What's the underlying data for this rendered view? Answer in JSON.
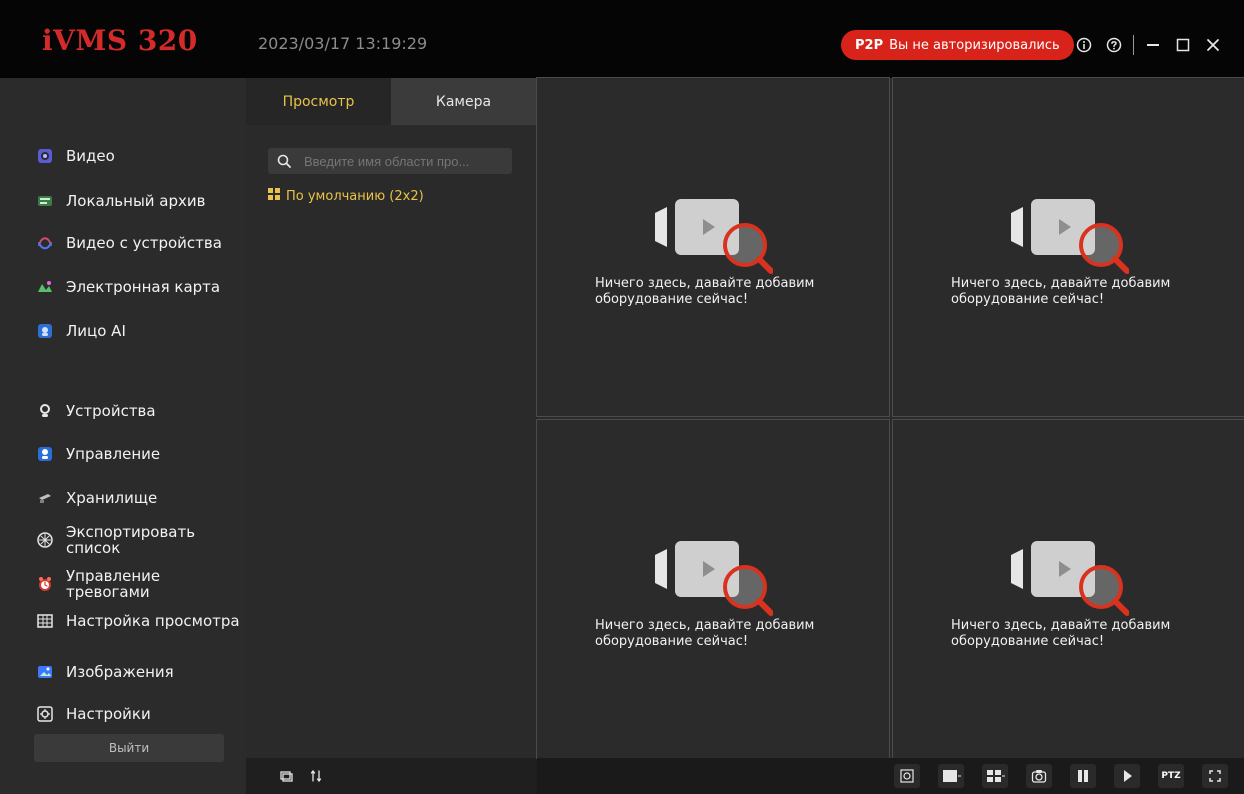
{
  "app": {
    "title": "iVMS 320",
    "datetime": "2023/03/17 13:19:29"
  },
  "p2p": {
    "badge": "P2P",
    "status": "Вы не авторизировались",
    "color": "#d8231a"
  },
  "window_controls": {
    "icons": [
      "info-icon",
      "help-icon",
      "minimize-icon",
      "maximize-icon",
      "close-icon"
    ]
  },
  "sidebar": {
    "items": [
      {
        "label": "Видео",
        "icon": "video-icon"
      },
      {
        "label": "Локальный архив",
        "icon": "local-archive-icon"
      },
      {
        "label": "Видео с устройства",
        "icon": "device-video-icon"
      },
      {
        "label": "Электронная карта",
        "icon": "emap-icon"
      },
      {
        "label": "Лицо AI",
        "icon": "face-ai-icon"
      },
      {
        "label": "Устройства",
        "icon": "devices-icon"
      },
      {
        "label": "Управление",
        "icon": "management-icon"
      },
      {
        "label": "Хранилище",
        "icon": "storage-icon"
      },
      {
        "label": "Экспортировать список",
        "icon": "export-list-icon"
      },
      {
        "label": "Управление тревогами",
        "icon": "alarm-management-icon"
      },
      {
        "label": "Настройка просмотра",
        "icon": "view-settings-icon"
      },
      {
        "label": "Изображения",
        "icon": "images-icon"
      },
      {
        "label": "Настройки",
        "icon": "settings-icon"
      }
    ],
    "logout_label": "Выйти"
  },
  "panel": {
    "tabs": [
      {
        "label": "Просмотр",
        "active": true
      },
      {
        "label": "Камера",
        "active": false
      }
    ],
    "search_placeholder": "Введите имя области про...",
    "view_item": "По умолчанию (2x2)"
  },
  "grid": {
    "layout": "2x2",
    "empty_message": "Ничего здесь, давайте добавим оборудование сейчас!"
  },
  "bottom_bar": {
    "left_icons": [
      "window-icon",
      "sort-icon"
    ],
    "right_icons": [
      "camera-switch-icon",
      "single-view-icon",
      "layout-icon",
      "snapshot-icon",
      "pause-icon",
      "play-icon",
      "ptz-icon",
      "fullscreen-icon"
    ],
    "ptz_label": "PTZ"
  }
}
